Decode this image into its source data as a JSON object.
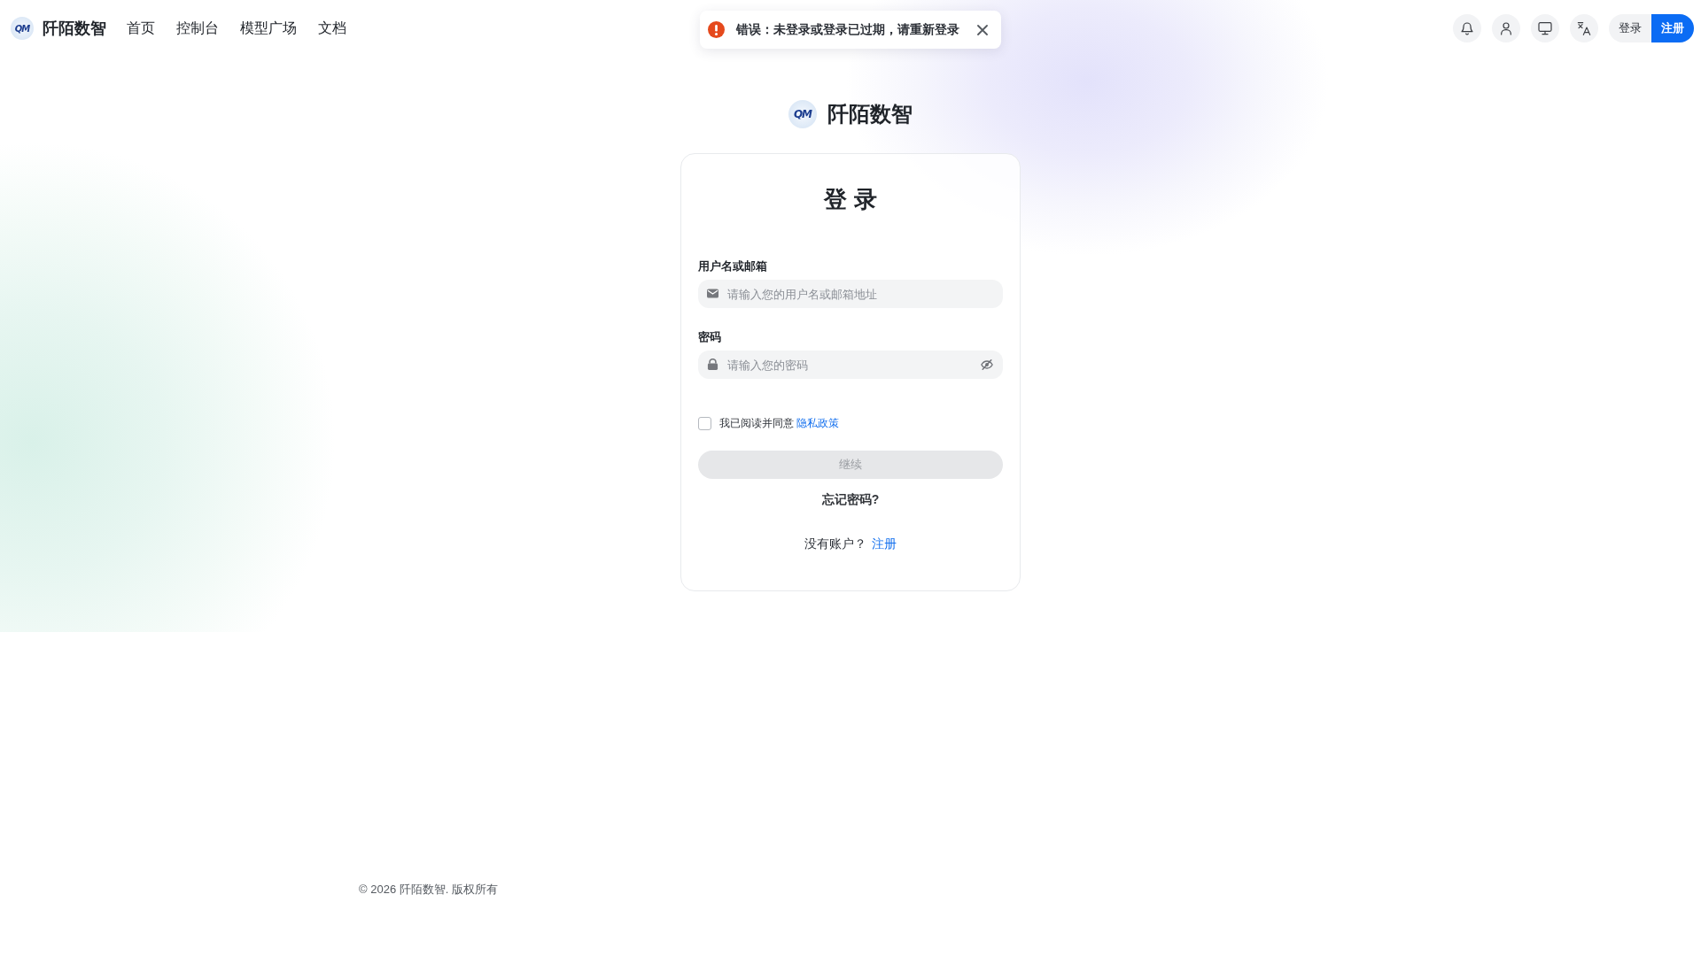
{
  "header": {
    "brand": {
      "mark": "QM",
      "name": "阡陌数智"
    },
    "nav_links": [
      "首页",
      "控制台",
      "模型广场",
      "文档"
    ],
    "auth_buttons": [
      {
        "label": "登录",
        "primary": false
      },
      {
        "label": "注册",
        "primary": true
      }
    ]
  },
  "toast": {
    "kind": "error",
    "message": "错误：未登录或登录已过期，请重新登录"
  },
  "login": {
    "brand": {
      "mark": "QM",
      "name": "阡陌数智"
    },
    "title": "登录",
    "fields": [
      {
        "kind": "email",
        "label": "用户名或邮箱",
        "placeholder": "请输入您的用户名或邮箱地址"
      },
      {
        "kind": "password",
        "label": "密码",
        "placeholder": "请输入您的密码",
        "reveal": false
      }
    ],
    "agreement": {
      "checked": false,
      "text": "我已阅读并同意",
      "link": "隐私政策"
    },
    "submit": {
      "label": "继续",
      "disabled": true
    },
    "forgot_link": "忘记密码?",
    "signup": {
      "text": "没有账户？",
      "link": "注册"
    }
  },
  "footer": {
    "copyright": "© 2026 阡陌数智. 版权所有"
  }
}
